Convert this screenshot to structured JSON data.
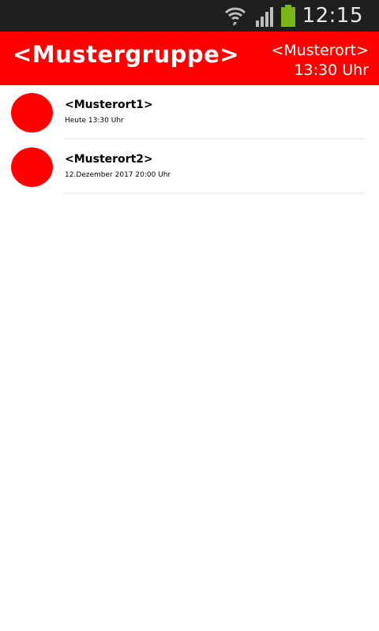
{
  "statusbar": {
    "time": "12:15",
    "icons": [
      "wifi-icon",
      "signal-icon",
      "battery-icon"
    ],
    "battery_color": "#7cb518"
  },
  "header": {
    "title": "<Mustergruppe>",
    "place": "<Musterort>",
    "time": "13:30 Uhr",
    "color": "#ff0000"
  },
  "list": {
    "items": [
      {
        "title": "<Musterort1>",
        "subtitle": "Heute 13:30 Uhr",
        "avatar_color": "#ff0000"
      },
      {
        "title": "<Musterort2>",
        "subtitle": "12.Dezember 2017 20:00 Uhr",
        "avatar_color": "#ff0000"
      }
    ]
  }
}
